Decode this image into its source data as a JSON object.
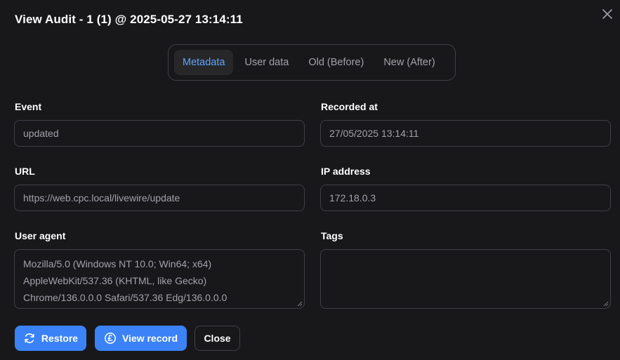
{
  "modal": {
    "title": "View Audit - 1 (1) @ 2025-05-27 13:14:11",
    "close_icon": "close-icon"
  },
  "tabs": [
    {
      "label": "Metadata",
      "active": true
    },
    {
      "label": "User data",
      "active": false
    },
    {
      "label": "Old (Before)",
      "active": false
    },
    {
      "label": "New (After)",
      "active": false
    }
  ],
  "fields": {
    "event": {
      "label": "Event",
      "value": "updated"
    },
    "recorded_at": {
      "label": "Recorded at",
      "value": "27/05/2025 13:14:11"
    },
    "url": {
      "label": "URL",
      "value": "https://web.cpc.local/livewire/update"
    },
    "ip_address": {
      "label": "IP address",
      "value": "172.18.0.3"
    },
    "user_agent": {
      "label": "User agent",
      "value": "Mozilla/5.0 (Windows NT 10.0; Win64; x64)\nAppleWebKit/537.36 (KHTML, like Gecko)\nChrome/136.0.0.0 Safari/537.36 Edg/136.0.0.0"
    },
    "tags": {
      "label": "Tags",
      "value": ""
    }
  },
  "actions": {
    "restore": {
      "label": "Restore",
      "icon": "refresh-icon"
    },
    "view_record": {
      "label": "View record",
      "icon": "pound-circle-icon"
    },
    "close": {
      "label": "Close"
    }
  },
  "colors": {
    "background": "#18181b",
    "border": "#3f3f46",
    "accent": "#3b82f6",
    "active_tab_text": "#60a5fa",
    "muted_text": "#a1a1aa"
  }
}
